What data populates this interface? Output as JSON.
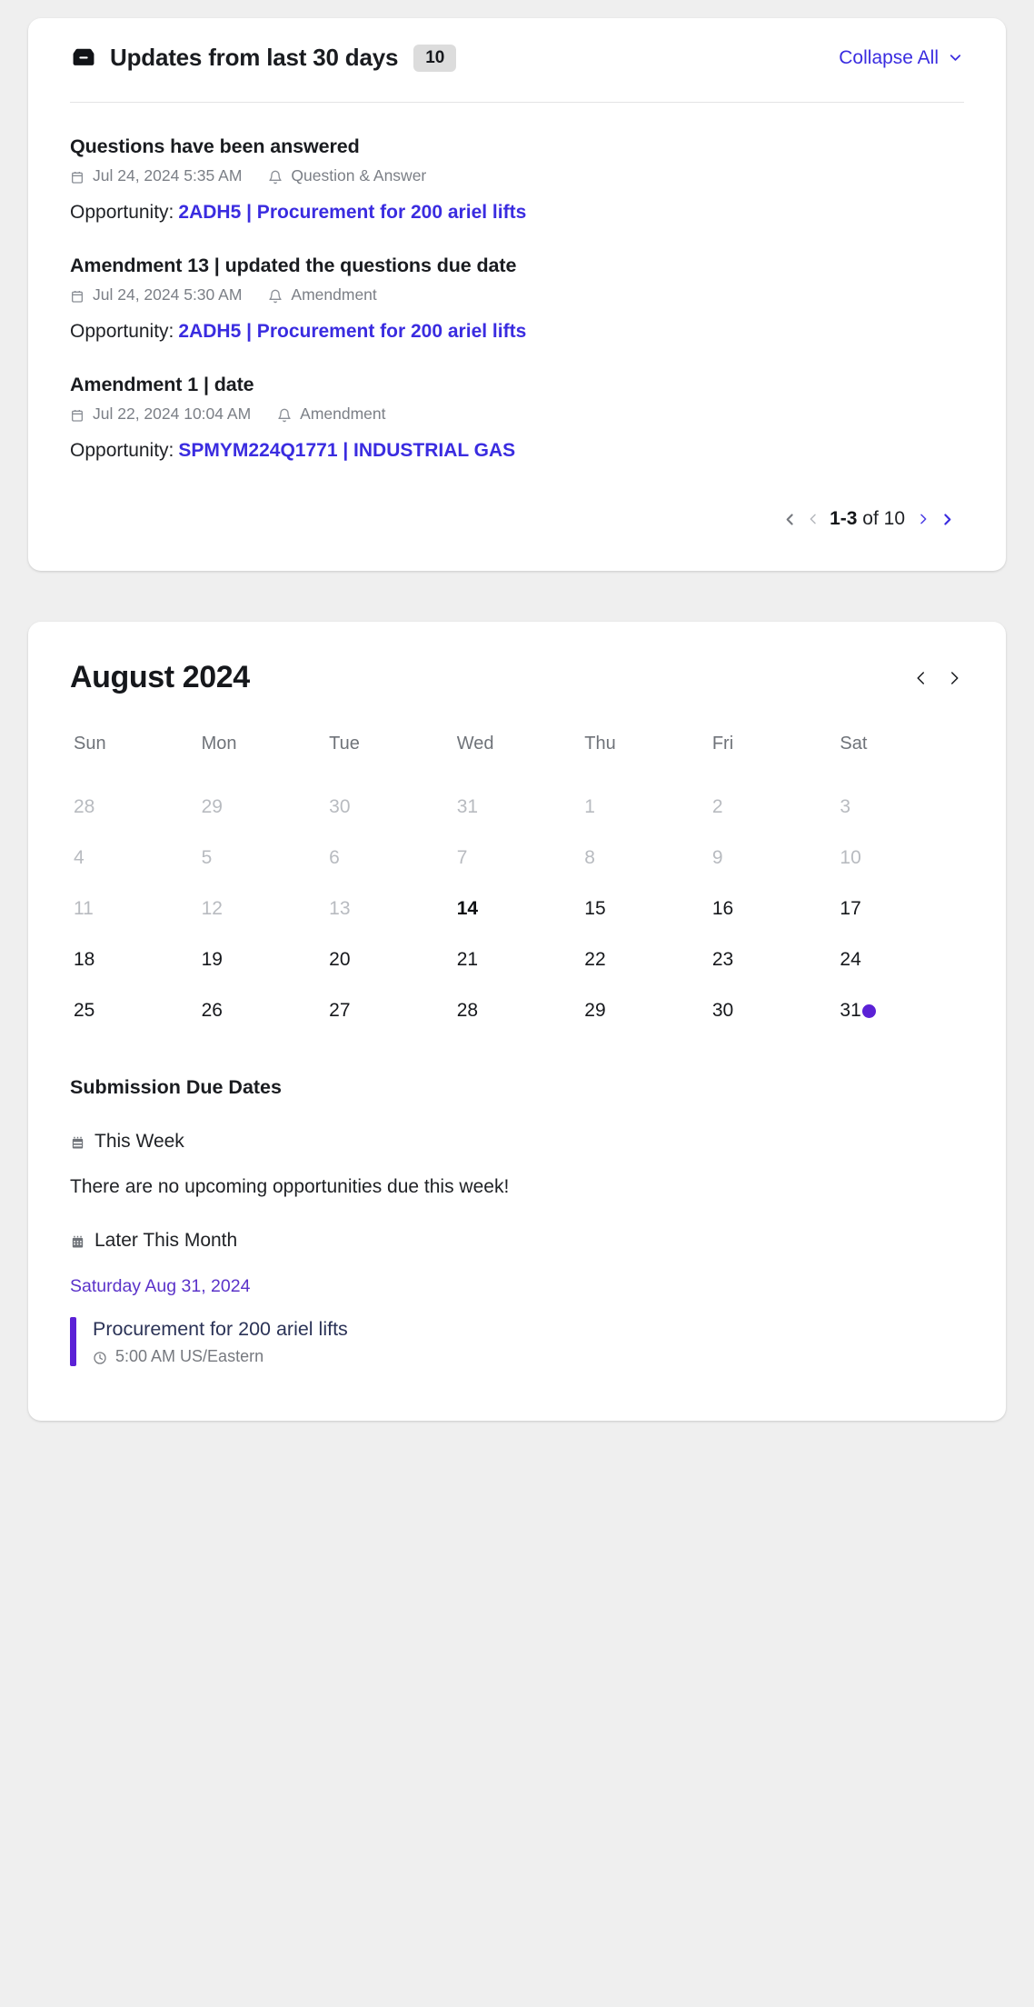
{
  "updates_panel": {
    "icon": "inbox-icon",
    "title": "Updates from last 30 days",
    "count_badge": "10",
    "collapse_label": "Collapse All",
    "collapse_icon": "chevron-down-icon",
    "items": [
      {
        "heading": "Questions have been answered",
        "date_icon": "calendar-icon",
        "date": "Jul 24, 2024 5:35 AM",
        "type_icon": "bell-icon",
        "type": "Question & Answer",
        "opportunity_label": "Opportunity:",
        "opportunity_link": "2ADH5 | Procurement for 200 ariel lifts"
      },
      {
        "heading": "Amendment 13 | updated the questions due date",
        "date_icon": "calendar-icon",
        "date": "Jul 24, 2024 5:30 AM",
        "type_icon": "bell-icon",
        "type": "Amendment",
        "opportunity_label": "Opportunity:",
        "opportunity_link": "2ADH5 | Procurement for 200 ariel lifts"
      },
      {
        "heading": "Amendment 1 | date",
        "date_icon": "calendar-icon",
        "date": "Jul 22, 2024 10:04 AM",
        "type_icon": "bell-icon",
        "type": "Amendment",
        "opportunity_label": "Opportunity:",
        "opportunity_link": "SPMYM224Q1771 | INDUSTRIAL GAS"
      }
    ],
    "pagination": {
      "first_icon": "chevron-first-icon",
      "prev_icon": "chevron-left-icon",
      "range": "1-3",
      "of_text": " of 10",
      "next_icon": "chevron-right-icon",
      "last_icon": "chevron-last-icon"
    }
  },
  "calendar_panel": {
    "month_title": "August 2024",
    "prev_icon": "chevron-left-icon",
    "next_icon": "chevron-right-icon",
    "day_headers": [
      "Sun",
      "Mon",
      "Tue",
      "Wed",
      "Thu",
      "Fri",
      "Sat"
    ],
    "days": [
      {
        "n": "28",
        "state": "muted"
      },
      {
        "n": "29",
        "state": "muted"
      },
      {
        "n": "30",
        "state": "muted"
      },
      {
        "n": "31",
        "state": "muted"
      },
      {
        "n": "1",
        "state": "muted"
      },
      {
        "n": "2",
        "state": "muted"
      },
      {
        "n": "3",
        "state": "muted"
      },
      {
        "n": "4",
        "state": "muted"
      },
      {
        "n": "5",
        "state": "muted"
      },
      {
        "n": "6",
        "state": "muted"
      },
      {
        "n": "7",
        "state": "muted"
      },
      {
        "n": "8",
        "state": "muted"
      },
      {
        "n": "9",
        "state": "muted"
      },
      {
        "n": "10",
        "state": "muted"
      },
      {
        "n": "11",
        "state": "muted"
      },
      {
        "n": "12",
        "state": "muted"
      },
      {
        "n": "13",
        "state": "muted"
      },
      {
        "n": "14",
        "state": "today"
      },
      {
        "n": "15",
        "state": "normal"
      },
      {
        "n": "16",
        "state": "normal"
      },
      {
        "n": "17",
        "state": "normal"
      },
      {
        "n": "18",
        "state": "normal"
      },
      {
        "n": "19",
        "state": "normal"
      },
      {
        "n": "20",
        "state": "normal"
      },
      {
        "n": "21",
        "state": "normal"
      },
      {
        "n": "22",
        "state": "normal"
      },
      {
        "n": "23",
        "state": "normal"
      },
      {
        "n": "24",
        "state": "normal"
      },
      {
        "n": "25",
        "state": "normal"
      },
      {
        "n": "26",
        "state": "normal"
      },
      {
        "n": "27",
        "state": "normal"
      },
      {
        "n": "28",
        "state": "normal"
      },
      {
        "n": "29",
        "state": "normal"
      },
      {
        "n": "30",
        "state": "normal"
      },
      {
        "n": "31",
        "state": "normal",
        "dot": true
      }
    ],
    "due_dates": {
      "section_title": "Submission Due Dates",
      "this_week": {
        "icon": "calendar-week-icon",
        "label": "This Week",
        "empty_message": "There are no upcoming opportunities due this week!"
      },
      "later_this_month": {
        "icon": "calendar-month-icon",
        "label": "Later This Month",
        "date_label": "Saturday Aug 31, 2024",
        "events": [
          {
            "title": "Procurement for 200 ariel lifts",
            "time_icon": "clock-icon",
            "time": "5:00 AM US/Eastern"
          }
        ]
      }
    }
  },
  "colors": {
    "page_background": "#efefef",
    "card_background": "#ffffff",
    "link_blue": "#3a2ce0",
    "accent_purple": "#5b21d6",
    "date_label_purple": "#5b33c9",
    "text_primary": "#1a1c20",
    "text_muted": "#7b7f86",
    "day_muted": "#b8bbc0",
    "badge_background": "#dcdcdc",
    "event_title": "#2b3357"
  }
}
